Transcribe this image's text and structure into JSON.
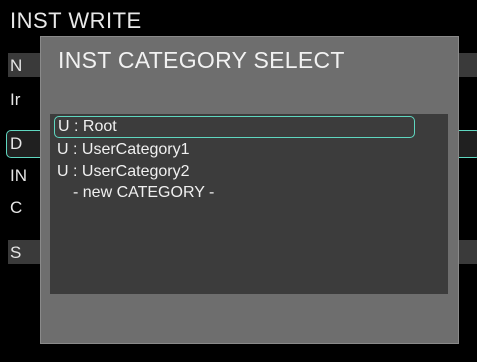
{
  "screen": {
    "title": "INST WRITE",
    "rows": [
      {
        "letter": "N"
      },
      {
        "letter": "Ir"
      },
      {
        "letter": "D"
      },
      {
        "letter": "IN"
      },
      {
        "letter": "C"
      },
      {
        "letter": "S"
      }
    ]
  },
  "dialog": {
    "title": "INST CATEGORY SELECT",
    "items": [
      {
        "label": "U : Root",
        "selected": true
      },
      {
        "label": "U : UserCategory1",
        "selected": false
      },
      {
        "label": "U : UserCategory2",
        "selected": false
      },
      {
        "label": "- new CATEGORY -",
        "selected": false
      }
    ],
    "accent_color": "#5fd7c0"
  }
}
